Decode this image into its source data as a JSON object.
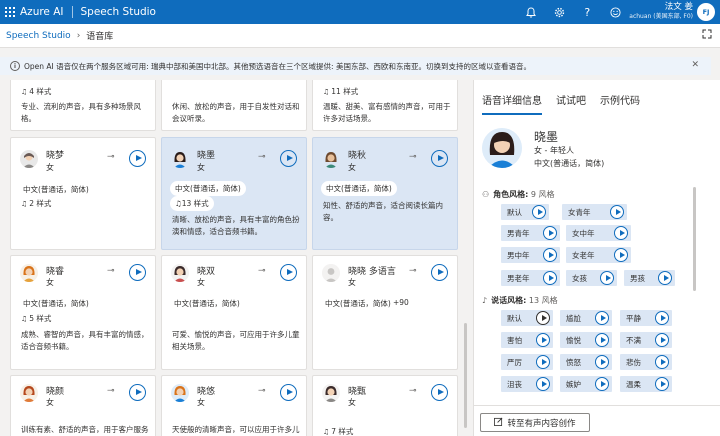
{
  "topbar": {
    "brand": "Azure AI",
    "app": "Speech Studio",
    "bell_icon": "bell-icon",
    "settings_icon": "gear-icon",
    "help": "?",
    "user_name": "法文 姜",
    "user_sub": "achuan (美国东部, F0)",
    "avatar_initials": "FJ"
  },
  "breadcrumb": {
    "root": "Speech Studio",
    "current": "语音库"
  },
  "banner": {
    "text": "Open AI 语音仅在两个服务区域可用: 瑞典中部和美国中北部。其他预选语音在三个区域提供: 美国东部、西欧和东南亚。切换到支持的区域以查看语音。"
  },
  "cards": [
    {
      "id": "r0c0",
      "styles": "4 样式",
      "desc": "专业、流利的声音，具有多种场景风格。"
    },
    {
      "id": "r0c1",
      "desc": "休闲、放松的声音，用于自发性对话和会议听录。"
    },
    {
      "id": "r0c2",
      "styles": "11 样式",
      "desc": "温暖、甜美、富有感情的声音，可用于许多对话场景。"
    },
    {
      "id": "xiaomeng",
      "name": "晓梦",
      "gender": "女",
      "lang": "中文(普通话，简体)",
      "styles": "2 样式"
    },
    {
      "id": "xiaomo",
      "name": "晓墨",
      "gender": "女",
      "lang": "中文(普通话，简体)",
      "styles": "13 样式",
      "desc": "清晰、放松的声音，具有丰富的角色扮演和情感，适合音频书籍。",
      "selected": true
    },
    {
      "id": "xiaoqiu",
      "name": "晓秋",
      "gender": "女",
      "lang": "中文(普通话，简体)",
      "desc": "知性、舒适的声音，适合阅读长篇内容。",
      "selected": true
    },
    {
      "id": "xiaorui",
      "name": "晓睿",
      "gender": "女",
      "lang": "中文(普通话，简体)",
      "styles": "5 样式",
      "desc": "成熟、睿智的声音，具有丰富的情感，适合音频书籍。"
    },
    {
      "id": "xiaoshuang",
      "name": "晓双",
      "gender": "女",
      "lang": "中文(普通话，简体)",
      "desc": "可爱、愉悦的声音，可应用于许多儿童相关场景。"
    },
    {
      "id": "xiaoxiao-multi",
      "name": "晓晓 多语言",
      "gender": "女",
      "lang": "中文(普通话，简体)",
      "extra": "+90"
    },
    {
      "id": "xiaoyan",
      "name": "晓颜",
      "gender": "女",
      "desc": "训练有素、舒适的声音，用于客户服务"
    },
    {
      "id": "xiaoyou",
      "name": "晓悠",
      "gender": "女",
      "desc": "天使般的清晰声音，可以应用于许多儿"
    },
    {
      "id": "xiaozhen",
      "name": "晓甄",
      "gender": "女",
      "styles": "7 样式"
    }
  ],
  "panel": {
    "tabs": [
      "语音详细信息",
      "试试吧",
      "示例代码"
    ],
    "name": "晓墨",
    "meta": "女 - 年轻人",
    "lang": "中文(普通话，简体)",
    "roles_title": "角色风格:",
    "roles_count": "9 风格",
    "roles": [
      "默认",
      "女青年",
      "男青年",
      "女中年",
      "男中年",
      "女老年",
      "男老年",
      "女孩",
      "男孩"
    ],
    "styles_title": "说话风格:",
    "styles_count": "13 风格",
    "styles": [
      "默认",
      "尴尬",
      "平静",
      "害怕",
      "愉悦",
      "不满",
      "严厉",
      "愤怒",
      "悲伤",
      "沮丧",
      "嫉妒",
      "温柔"
    ],
    "button": "转至有声内容创作"
  }
}
